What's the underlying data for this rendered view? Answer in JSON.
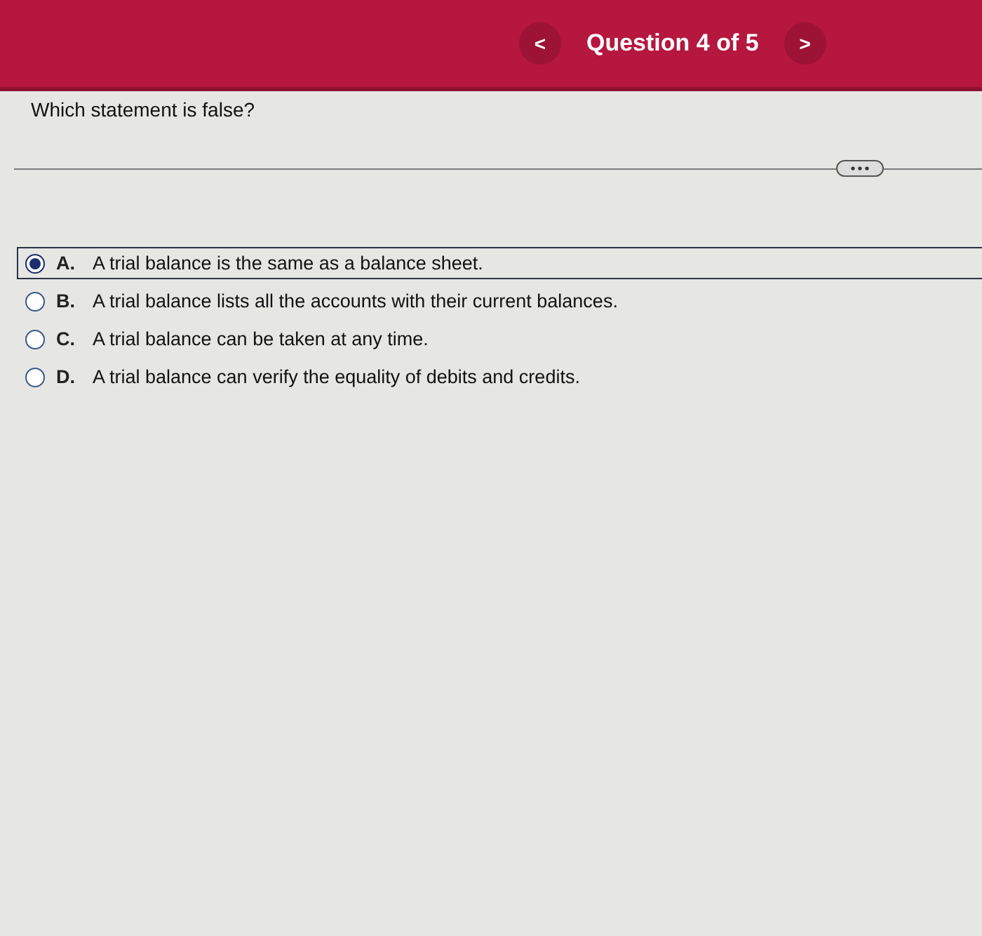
{
  "header": {
    "prev_label": "<",
    "title": "Question 4 of 5",
    "next_label": ">"
  },
  "question": "Which statement is false?",
  "options": [
    {
      "letter": "A.",
      "text": "A trial balance is the same as a balance sheet.",
      "selected": true
    },
    {
      "letter": "B.",
      "text": "A trial balance lists all the accounts with their current balances.",
      "selected": false
    },
    {
      "letter": "C.",
      "text": "A trial balance can be taken at any time.",
      "selected": false
    },
    {
      "letter": "D.",
      "text": "A trial balance can verify the equality of debits and credits.",
      "selected": false
    }
  ]
}
